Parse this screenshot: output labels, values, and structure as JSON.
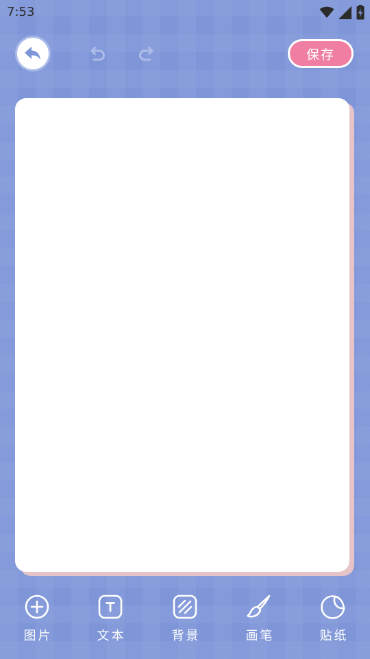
{
  "status_bar": {
    "time": "7:53",
    "icons": [
      "wifi-icon",
      "cellular-signal-icon",
      "battery-charging-icon"
    ]
  },
  "toolbar": {
    "back_icon": "back-arrow-icon",
    "undo_icon": "undo-icon",
    "redo_icon": "redo-icon",
    "save_label": "保存"
  },
  "bottom_tools": [
    {
      "id": "image",
      "label": "图片",
      "icon": "add-circle-icon"
    },
    {
      "id": "text",
      "label": "文本",
      "icon": "text-box-icon"
    },
    {
      "id": "background",
      "label": "背景",
      "icon": "striped-square-icon"
    },
    {
      "id": "brush",
      "label": "画笔",
      "icon": "paintbrush-icon"
    },
    {
      "id": "sticker",
      "label": "贴纸",
      "icon": "sticker-icon"
    }
  ],
  "colors": {
    "background": "#7e95d8",
    "save_button": "#f07ea2",
    "canvas": "#ffffff",
    "canvas_shadow": "#e6c3c7",
    "disabled_icon": "#aebde9"
  }
}
